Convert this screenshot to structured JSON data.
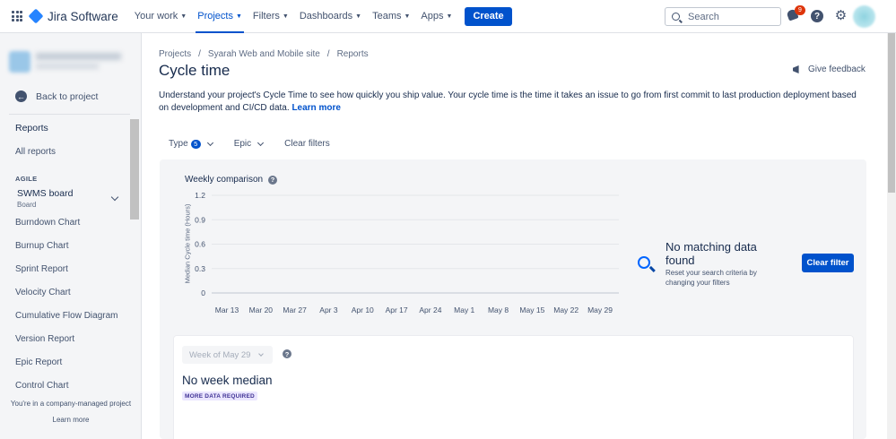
{
  "topnav": {
    "logo_text": "Jira Software",
    "items": [
      {
        "label": "Your work"
      },
      {
        "label": "Projects"
      },
      {
        "label": "Filters"
      },
      {
        "label": "Dashboards"
      },
      {
        "label": "Teams"
      },
      {
        "label": "Apps"
      }
    ],
    "create_label": "Create",
    "search_placeholder": "Search",
    "notification_count": "9",
    "help_glyph": "?"
  },
  "sidebar": {
    "back_label": "Back to project",
    "reports_heading": "Reports",
    "all_reports": "All reports",
    "section_label": "AGILE",
    "board_name": "SWMS board",
    "board_sub": "Board",
    "links": [
      {
        "label": "Burndown Chart"
      },
      {
        "label": "Burnup Chart"
      },
      {
        "label": "Sprint Report"
      },
      {
        "label": "Velocity Chart"
      },
      {
        "label": "Cumulative Flow Diagram"
      },
      {
        "label": "Version Report"
      },
      {
        "label": "Epic Report"
      },
      {
        "label": "Control Chart"
      }
    ],
    "footer_text": "You're in a company-managed project",
    "learn_more": "Learn more"
  },
  "breadcrumb": [
    "Projects",
    "/",
    "Syarah Web and Mobile site",
    "/",
    "Reports"
  ],
  "page": {
    "title": "Cycle time",
    "give_feedback": "Give feedback",
    "description": "Understand your project's Cycle Time to see how quickly you ship value. Your cycle time is the time it takes an issue to go from first commit to last production deployment based on development and CI/CD data.",
    "learn_more": "Learn more"
  },
  "filters": {
    "type_label": "Type",
    "type_count": "5",
    "epic_label": "Epic",
    "clear_label": "Clear filters"
  },
  "chart_data": {
    "type": "line",
    "title": "Weekly comparison",
    "xlabel": "",
    "ylabel": "Median Cycle time (Hours)",
    "categories": [
      "Mar 13",
      "Mar 20",
      "Mar 27",
      "Apr 3",
      "Apr 10",
      "Apr 17",
      "Apr 24",
      "May 1",
      "May 8",
      "May 15",
      "May 22",
      "May 29"
    ],
    "yticks": [
      "1.2",
      "0.9",
      "0.6",
      "0.3",
      "0"
    ],
    "ylim": [
      0,
      1.2
    ],
    "grid": true,
    "series": []
  },
  "empty_state": {
    "title": "No matching data found",
    "text": "Reset your search criteria by changing your filters",
    "button_label": "Clear filter"
  },
  "week_card": {
    "selector_value": "Week of May 29",
    "median_text": "No week median",
    "lozenge": "MORE DATA REQUIRED"
  },
  "colors": {
    "brand_blue": "#0052cc",
    "badge_red": "#de350b",
    "lozenge_bg": "#eae6ff",
    "lozenge_text": "#403294"
  }
}
